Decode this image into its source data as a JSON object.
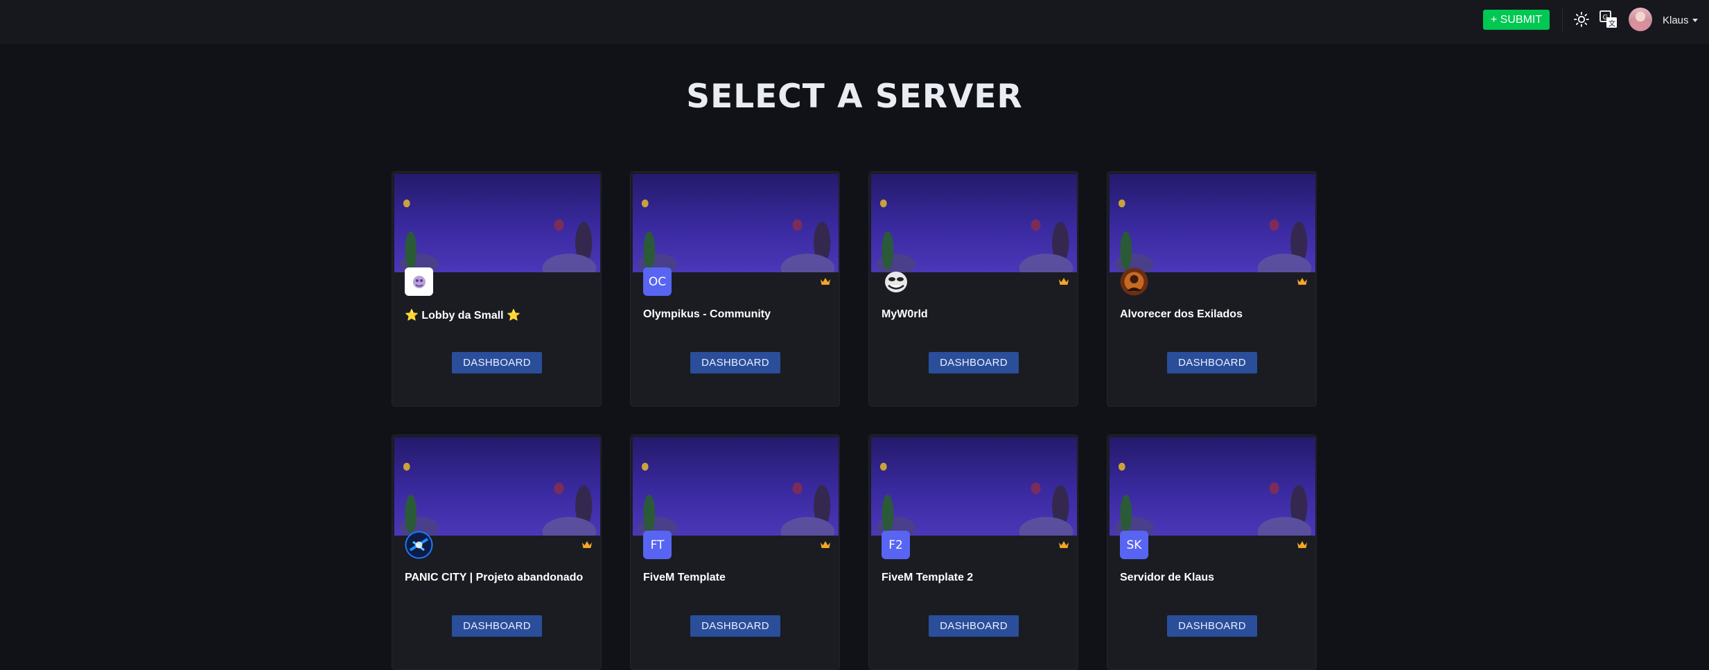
{
  "topbar": {
    "submit_label": "+ SUBMIT",
    "user_name": "Klaus",
    "accent_color": "#00c853"
  },
  "page": {
    "title": "SELECT A SERVER"
  },
  "servers": [
    {
      "name": "⭐ Lobby da Small ⭐",
      "icon_type": "image-white",
      "initials": "",
      "owner_crown": false,
      "button": "DASHBOARD"
    },
    {
      "name": "Olympikus - Community",
      "icon_type": "initials",
      "initials": "OC",
      "owner_crown": true,
      "button": "DASHBOARD"
    },
    {
      "name": "MyW0rld",
      "icon_type": "image-troll",
      "initials": "",
      "owner_crown": true,
      "button": "DASHBOARD"
    },
    {
      "name": "Alvorecer dos Exilados",
      "icon_type": "image-warrior",
      "initials": "",
      "owner_crown": true,
      "button": "DASHBOARD"
    },
    {
      "name": "PANIC CITY | Projeto abandonado",
      "icon_type": "image-panic",
      "initials": "",
      "owner_crown": true,
      "button": "DASHBOARD"
    },
    {
      "name": "FiveM Template",
      "icon_type": "initials",
      "initials": "FT",
      "owner_crown": true,
      "button": "DASHBOARD"
    },
    {
      "name": "FiveM Template 2",
      "icon_type": "initials",
      "initials": "F2",
      "owner_crown": true,
      "button": "DASHBOARD"
    },
    {
      "name": "Servidor de Klaus",
      "icon_type": "initials",
      "initials": "SK",
      "owner_crown": true,
      "button": "DASHBOARD"
    }
  ]
}
